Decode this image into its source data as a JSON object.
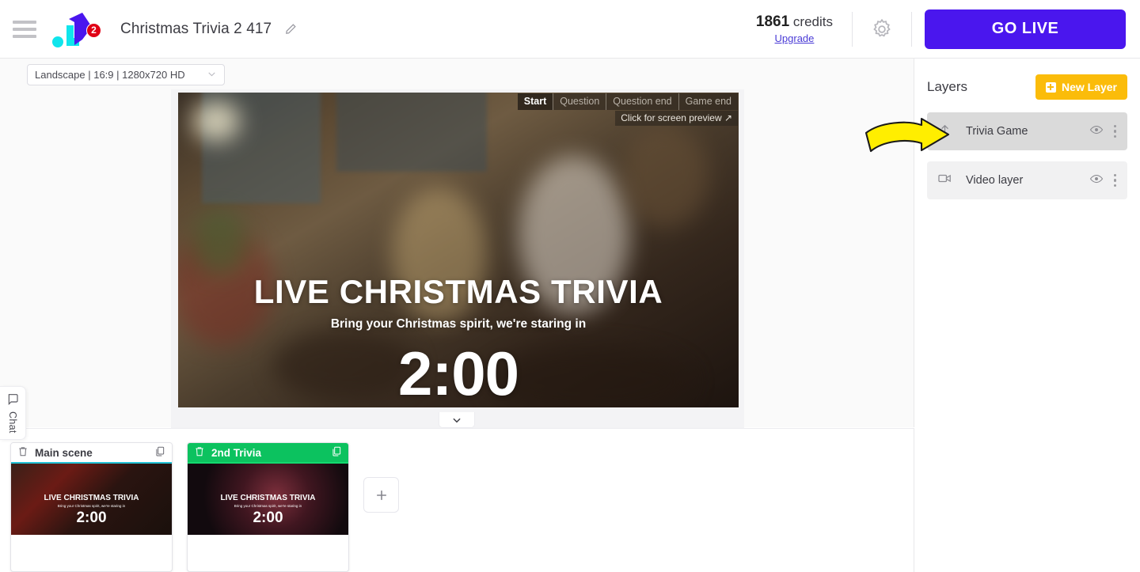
{
  "topbar": {
    "menu_icon": "hamburger-icon",
    "logo_icon": "brand-logo",
    "notification_count": "2",
    "project_title": "Christmas Trivia 2 417",
    "edit_icon": "pencil-icon",
    "credits_value": "1861",
    "credits_label": "credits",
    "upgrade_label": "Upgrade",
    "settings_icon": "gear-icon",
    "go_live_label": "GO LIVE",
    "go_live_color": "#4a16ee"
  },
  "stage": {
    "ratio_select_value": "Landscape | 16:9 | 1280x720 HD",
    "chevron_icon": "chevron-down-icon",
    "segment_tabs": [
      {
        "label": "Start",
        "active": true
      },
      {
        "label": "Question",
        "active": false
      },
      {
        "label": "Question end",
        "active": false
      },
      {
        "label": "Game end",
        "active": false
      }
    ],
    "preview_hint": "Click for screen preview ↗",
    "overlay": {
      "title": "LIVE CHRISTMAS TRIVIA",
      "subtitle": "Bring your Christmas spirit, we're staring in",
      "timer": "2:00"
    },
    "collapse_icon": "chevron-down-icon",
    "chat_tab_label": "Chat",
    "chat_tab_icon": "chat-bubble-icon"
  },
  "scenes": {
    "items": [
      {
        "name": "Main scene",
        "active": false,
        "delete_icon": "trash-icon",
        "duplicate_icon": "copy-icon",
        "thumb_title": "LIVE CHRISTMAS TRIVIA",
        "thumb_subtitle": "Bring your Christmas spirit, we're staring in",
        "thumb_timer": "2:00"
      },
      {
        "name": "2nd Trivia",
        "active": true,
        "delete_icon": "trash-icon",
        "duplicate_icon": "copy-icon",
        "thumb_title": "LIVE CHRISTMAS TRIVIA",
        "thumb_subtitle": "Bring your Christmas spirit, we're staring in",
        "thumb_timer": "2:00"
      }
    ],
    "add_scene_icon": "plus-icon",
    "active_color": "#0cc25f",
    "inactive_underline_color": "#22c2d6"
  },
  "layers": {
    "title": "Layers",
    "new_layer_label": "New Layer",
    "new_layer_icon": "plus-square-icon",
    "new_layer_color": "#fbbc0a",
    "items": [
      {
        "name": "Trivia Game",
        "selected": true,
        "type_icon": "game-layer-icon",
        "visibility_icon": "eye-icon",
        "menu_icon": "kebab-menu-icon"
      },
      {
        "name": "Video layer",
        "selected": false,
        "type_icon": "video-camera-icon",
        "visibility_icon": "eye-icon",
        "menu_icon": "kebab-menu-icon"
      }
    ]
  },
  "annotation": {
    "arrow_icon": "yellow-curved-arrow",
    "arrow_color": "#ffee00"
  }
}
